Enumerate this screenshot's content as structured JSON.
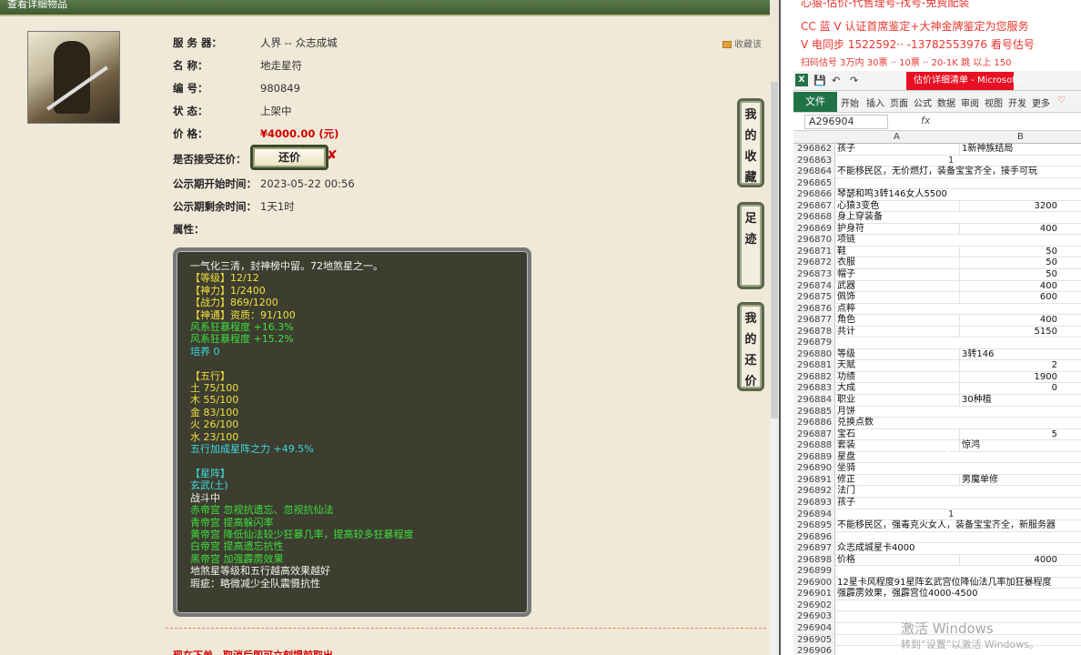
{
  "left_page": {
    "top_bar_title": "查看详细物品",
    "favorite_label": "收藏该",
    "info_rows": [
      {
        "label": "服 务 器：",
        "value": "人界 -- 众志成城"
      },
      {
        "label": "名        称：",
        "value": "地走星符"
      },
      {
        "label": "编        号：",
        "value": "980849"
      },
      {
        "label": "状        态：",
        "value": "上架中"
      },
      {
        "label": "价        格：",
        "value": "¥4000.00 (元)"
      }
    ],
    "haggle_label": "是否接受还价：",
    "haggle_button": "还价",
    "haggle_x": "✘",
    "publicity_start_label": "公示期开始时间：",
    "publicity_start_value": "2023-05-22 00:56",
    "publicity_remaining_label": "公示期剩余时间：",
    "publicity_remaining_value": "1天1时",
    "attributes_label": "属性：",
    "attributes_lines": [
      {
        "text": "一气化三清，封神榜中留。72地煞星之一。",
        "color": "w"
      },
      {
        "text": "【等级】12/12",
        "color": "y"
      },
      {
        "text": "【神力】1/2400",
        "color": "y"
      },
      {
        "text": "【战力】869/1200",
        "color": "y"
      },
      {
        "text": "【神通】资质：91/100",
        "color": "y"
      },
      {
        "text": "风系狂暴程度 +16.3%",
        "color": "g"
      },
      {
        "text": "风系狂暴程度 +15.2%",
        "color": "g"
      },
      {
        "text": "培养 0",
        "color": "c"
      },
      {
        "text": "",
        "color": "w"
      },
      {
        "text": "【五行】",
        "color": "y"
      },
      {
        "text": "土 75/100",
        "color": "y"
      },
      {
        "text": "木 55/100",
        "color": "y"
      },
      {
        "text": "金 83/100",
        "color": "y"
      },
      {
        "text": "火 26/100",
        "color": "y"
      },
      {
        "text": "水 23/100",
        "color": "y"
      },
      {
        "text": "五行加成星阵之力 +49.5%",
        "color": "c"
      },
      {
        "text": "",
        "color": "w"
      },
      {
        "text": "【星阵】",
        "color": "c"
      },
      {
        "text": "玄武(土)",
        "color": "c"
      },
      {
        "text": "战斗中",
        "color": "w"
      },
      {
        "text": "赤帝宫 忽视抗遗忘、忽视抗仙法",
        "color": "g"
      },
      {
        "text": "青帝宫 提高躲闪率",
        "color": "g"
      },
      {
        "text": "黄帝宫 降低仙法较少狂暴几率，提高较多狂暴程度",
        "color": "g"
      },
      {
        "text": "白帝宫 提高遗忘抗性",
        "color": "g"
      },
      {
        "text": "黑帝宫 加强霹雳效果",
        "color": "g"
      },
      {
        "text": "地煞星等级和五行越高效果越好",
        "color": "w"
      },
      {
        "text": "瑕疵：略微减少全队震慑抗性",
        "color": "w"
      }
    ],
    "bottom_notice": "现在下单，取消后即可立刻提前取出",
    "side_buttons": [
      {
        "label": "我的收藏"
      },
      {
        "label": "足迹"
      },
      {
        "label": "我的还价"
      }
    ]
  },
  "banner": {
    "line1": "心猿-估价-代售理号-找号-免费配装",
    "line2": "CC 蓝 V 认证首席鉴定+大神金牌鉴定为您服务",
    "line3": "V 电同步 1522592·· -13782553976 看号估号",
    "line4": "扫码估号 3万内 30票 ·· 10票 ·· 20-1K 跳 以上 150"
  },
  "excel": {
    "window_title": "估价详细清单 - Microsoft...",
    "quick_access": [
      "💾",
      "↶",
      "↷"
    ],
    "file_tab": "文件",
    "ribbon_tabs": [
      "开始",
      "插入",
      "页面",
      "公式",
      "数据",
      "审阅",
      "视图",
      "开发",
      "更多"
    ],
    "name_box": "A296904",
    "fx_label": "fx",
    "col_a": "A",
    "col_b": "B",
    "rows": [
      {
        "n": "296862",
        "a": "孩子",
        "b": "1新神族结局",
        "num": false
      },
      {
        "n": "296863",
        "a": "",
        "b": "",
        "mid": "1"
      },
      {
        "n": "296864",
        "a": "不能移民区，无价燃灯，装备宝宝齐全，接手可玩",
        "b": ""
      },
      {
        "n": "296865",
        "a": "",
        "b": ""
      },
      {
        "n": "296866",
        "a": "琴瑟和鸣3转146女人5500",
        "b": ""
      },
      {
        "n": "296867",
        "a": "心猿3变色",
        "b": "3200",
        "num": true
      },
      {
        "n": "296868",
        "a": "身上穿装备",
        "b": ""
      },
      {
        "n": "296869",
        "a": "护身符",
        "b": "400",
        "num": true
      },
      {
        "n": "296870",
        "a": "项链",
        "b": ""
      },
      {
        "n": "296871",
        "a": "鞋",
        "b": "50",
        "num": true
      },
      {
        "n": "296872",
        "a": "衣服",
        "b": "50",
        "num": true
      },
      {
        "n": "296873",
        "a": "帽子",
        "b": "50",
        "num": true
      },
      {
        "n": "296874",
        "a": "武器",
        "b": "400",
        "num": true
      },
      {
        "n": "296875",
        "a": "佩饰",
        "b": "600",
        "num": true
      },
      {
        "n": "296876",
        "a": "点粹",
        "b": ""
      },
      {
        "n": "296877",
        "a": "角色",
        "b": "400",
        "num": true
      },
      {
        "n": "296878",
        "a": "共计",
        "b": "5150",
        "num": true
      },
      {
        "n": "296879",
        "a": "",
        "b": ""
      },
      {
        "n": "296880",
        "a": "等级",
        "b": "3转146",
        "num": false
      },
      {
        "n": "296881",
        "a": "天赋",
        "b": "2",
        "num": true
      },
      {
        "n": "296882",
        "a": "功绩",
        "b": "1900",
        "num": true
      },
      {
        "n": "296883",
        "a": "大成",
        "b": "0",
        "num": true
      },
      {
        "n": "296884",
        "a": "职业",
        "b": "30种植",
        "num": false
      },
      {
        "n": "296885",
        "a": "月饼",
        "b": ""
      },
      {
        "n": "296886",
        "a": "兑换点数",
        "b": ""
      },
      {
        "n": "296887",
        "a": "宝石",
        "b": "5",
        "num": true
      },
      {
        "n": "296888",
        "a": "套装",
        "b": "惊鸿",
        "num": false
      },
      {
        "n": "296889",
        "a": "星盘",
        "b": ""
      },
      {
        "n": "296890",
        "a": "坐骑",
        "b": ""
      },
      {
        "n": "296891",
        "a": "修正",
        "b": "男魔单修",
        "num": false
      },
      {
        "n": "296892",
        "a": "法门",
        "b": ""
      },
      {
        "n": "296893",
        "a": "孩子",
        "b": ""
      },
      {
        "n": "296894",
        "a": "",
        "b": "",
        "mid": "1"
      },
      {
        "n": "296895",
        "a": "不能移民区，强毒克火女人，装备宝宝齐全，新服务器",
        "b": ""
      },
      {
        "n": "296896",
        "a": "",
        "b": ""
      },
      {
        "n": "296897",
        "a": "众志成城星卡4000",
        "b": ""
      },
      {
        "n": "296898",
        "a": "价格",
        "b": "4000",
        "num": true
      },
      {
        "n": "296899",
        "a": "",
        "b": ""
      },
      {
        "n": "296900",
        "a": "12星卡风程度91星阵玄武宫位降仙法几率加狂暴程度",
        "b": ""
      },
      {
        "n": "296901",
        "a": "强霹雳效果，强霹宫位4000-4500",
        "b": ""
      },
      {
        "n": "296902",
        "a": "",
        "b": ""
      },
      {
        "n": "296903",
        "a": "",
        "b": ""
      },
      {
        "n": "296904",
        "a": "",
        "b": ""
      },
      {
        "n": "296905",
        "a": "",
        "b": ""
      },
      {
        "n": "296906",
        "a": "",
        "b": ""
      }
    ]
  },
  "watermark_line1": "激活 Windows",
  "watermark_line2": "转到“设置”以激活 Windows。",
  "colors": {
    "accent_green": "#217346",
    "price_red": "#d10000"
  }
}
